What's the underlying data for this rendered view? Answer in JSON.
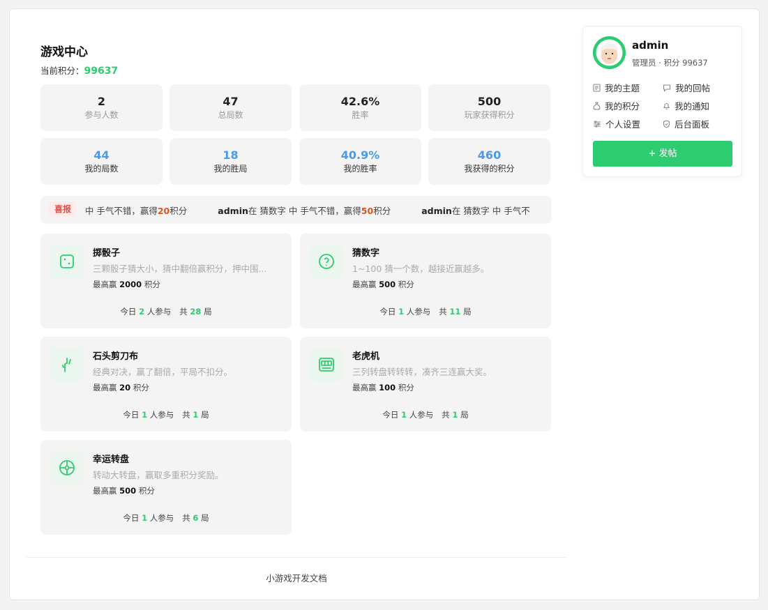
{
  "main": {
    "title": "游戏中心",
    "points_label": "当前积分：",
    "points_value": "99637"
  },
  "stats_global": [
    {
      "value": "2",
      "label": "参与人数"
    },
    {
      "value": "47",
      "label": "总局数"
    },
    {
      "value": "42.6%",
      "label": "胜率"
    },
    {
      "value": "500",
      "label": "玩家获得积分"
    }
  ],
  "stats_mine": [
    {
      "value": "44",
      "label": "我的局数"
    },
    {
      "value": "18",
      "label": "我的胜局"
    },
    {
      "value": "40.9%",
      "label": "我的胜率"
    },
    {
      "value": "460",
      "label": "我获得的积分"
    }
  ],
  "ticker": {
    "badge": "喜报",
    "items": [
      {
        "user": "",
        "pre": "E 中 手气不错，赢得",
        "amount": "20",
        "suffix": "积分"
      },
      {
        "user": "admin",
        "pre": "在 猜数字 中 手气不错，赢得",
        "amount": "50",
        "suffix": "积分"
      },
      {
        "user": "admin",
        "pre": "在 猜数字 中 手气不",
        "amount": "",
        "suffix": ""
      }
    ]
  },
  "games": [
    {
      "name": "掷骰子",
      "desc": "三颗骰子猜大小，猜中翻倍赢积分，押中围...",
      "max_prefix": "最高赢",
      "max": "2000",
      "max_suffix": "积分",
      "today_prefix": "今日",
      "today": "2",
      "today_suffix": "人参与",
      "total_prefix": "共",
      "total": "28",
      "total_suffix": "局",
      "icon": "dice-icon"
    },
    {
      "name": "猜数字",
      "desc": "1~100 猜一个数，越接近赢越多。",
      "max_prefix": "最高赢",
      "max": "500",
      "max_suffix": "积分",
      "today_prefix": "今日",
      "today": "1",
      "today_suffix": "人参与",
      "total_prefix": "共",
      "total": "11",
      "total_suffix": "局",
      "icon": "question-icon"
    },
    {
      "name": "石头剪刀布",
      "desc": "经典对决，赢了翻倍，平局不扣分。",
      "max_prefix": "最高赢",
      "max": "20",
      "max_suffix": "积分",
      "today_prefix": "今日",
      "today": "1",
      "today_suffix": "人参与",
      "total_prefix": "共",
      "total": "1",
      "total_suffix": "局",
      "icon": "hand-icon"
    },
    {
      "name": "老虎机",
      "desc": "三列转盘转转转，凑齐三连赢大奖。",
      "max_prefix": "最高赢",
      "max": "100",
      "max_suffix": "积分",
      "today_prefix": "今日",
      "today": "1",
      "today_suffix": "人参与",
      "total_prefix": "共",
      "total": "1",
      "total_suffix": "局",
      "icon": "slot-machine-icon"
    },
    {
      "name": "幸运转盘",
      "desc": "转动大转盘，赢取多重积分奖励。",
      "max_prefix": "最高赢",
      "max": "500",
      "max_suffix": "积分",
      "today_prefix": "今日",
      "today": "1",
      "today_suffix": "人参与",
      "total_prefix": "共",
      "total": "6",
      "total_suffix": "局",
      "icon": "wheel-icon"
    }
  ],
  "footer": {
    "link": "小游戏开发文档"
  },
  "user": {
    "name": "admin",
    "role": "管理员 · 积分 99637",
    "menu": [
      "我的主题",
      "我的回帖",
      "我的积分",
      "我的通知",
      "个人设置",
      "后台面板"
    ],
    "post_button": "+ 发帖"
  },
  "colors": {
    "accent": "#2ecc71",
    "mine_stat": "#4a9ae8",
    "ticker_amount": "#e0531f",
    "badge": "#d9534f"
  }
}
